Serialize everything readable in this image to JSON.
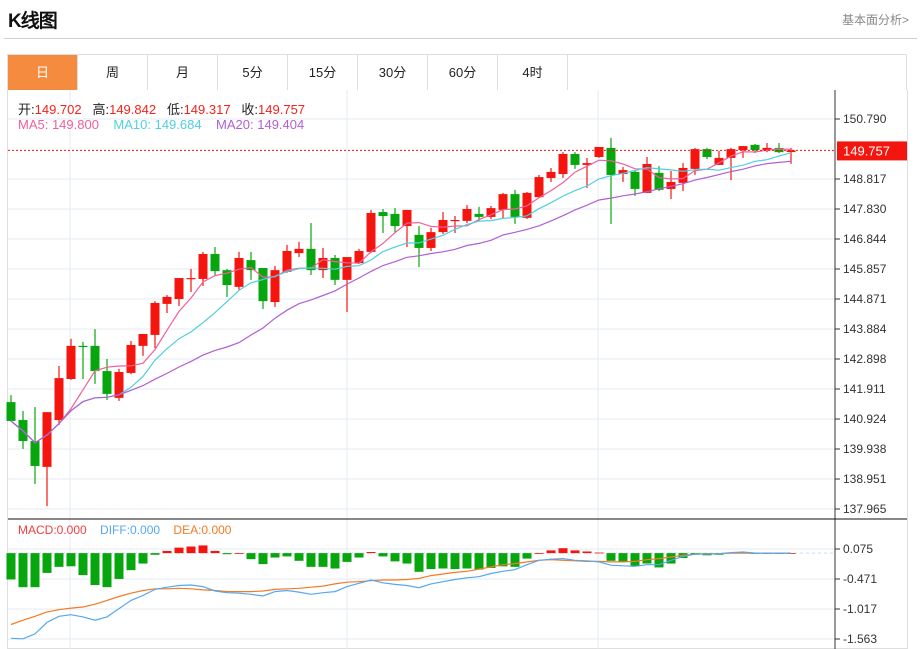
{
  "header": {
    "title": "K线图",
    "link": "基本面分析>"
  },
  "tabs": [
    {
      "label": "日",
      "active": true
    },
    {
      "label": "周"
    },
    {
      "label": "月"
    },
    {
      "label": "5分"
    },
    {
      "label": "15分"
    },
    {
      "label": "30分"
    },
    {
      "label": "60分"
    },
    {
      "label": "4时"
    }
  ],
  "ohlc_legend": {
    "open_label": "开:",
    "open": "149.702",
    "high_label": "高:",
    "high": "149.842",
    "low_label": "低:",
    "low": "149.317",
    "close_label": "收:",
    "close": "149.757"
  },
  "ma_legend": {
    "ma5": "MA5: 149.800",
    "ma10": "MA10: 149.684",
    "ma20": "MA20: 149.404"
  },
  "macd_legend": {
    "macd": "MACD:0.000",
    "diff": "DIFF:0.000",
    "dea": "DEA:0.000"
  },
  "colors": {
    "up": "#f5150f",
    "down": "#08a60e",
    "ma5": "#f0609a",
    "ma10": "#4fcfe0",
    "ma20": "#b25fd2",
    "diff": "#55a8f0",
    "dea": "#f47a24",
    "tab_active": "#f48b3f"
  },
  "chart_data": [
    {
      "type": "candlestick",
      "title": "",
      "y_ticks": [
        "150.790",
        "148.817",
        "147.830",
        "146.844",
        "145.857",
        "144.871",
        "143.884",
        "142.898",
        "141.911",
        "140.924",
        "139.938",
        "138.951",
        "137.965"
      ],
      "ylim": [
        137.965,
        150.79
      ],
      "last_price": "149.757",
      "grid": true,
      "candles": [
        [
          141.48,
          141.71,
          140.86,
          140.86
        ],
        [
          140.89,
          141.19,
          139.94,
          140.2
        ],
        [
          140.2,
          141.32,
          138.79,
          139.38
        ],
        [
          139.35,
          141.15,
          138.06,
          141.15
        ],
        [
          140.89,
          142.67,
          140.73,
          142.27
        ],
        [
          142.24,
          143.56,
          142.21,
          143.33
        ],
        [
          143.33,
          143.46,
          142.24,
          143.29
        ],
        [
          143.33,
          143.88,
          142.08,
          142.5
        ],
        [
          142.5,
          142.9,
          141.55,
          141.75
        ],
        [
          141.62,
          142.57,
          141.52,
          142.47
        ],
        [
          142.44,
          143.49,
          142.4,
          143.36
        ],
        [
          143.33,
          143.72,
          143.0,
          143.72
        ],
        [
          143.69,
          144.8,
          143.26,
          144.74
        ],
        [
          144.71,
          145.0,
          144.41,
          144.94
        ],
        [
          144.87,
          145.56,
          144.64,
          145.56
        ],
        [
          145.53,
          145.86,
          145.1,
          145.56
        ],
        [
          145.53,
          146.42,
          145.3,
          146.35
        ],
        [
          146.35,
          146.58,
          145.66,
          145.79
        ],
        [
          145.82,
          145.86,
          144.94,
          145.33
        ],
        [
          145.27,
          146.42,
          145.17,
          146.22
        ],
        [
          146.15,
          146.42,
          145.5,
          145.82
        ],
        [
          145.89,
          145.89,
          144.54,
          144.8
        ],
        [
          144.77,
          145.96,
          144.61,
          145.82
        ],
        [
          145.76,
          146.65,
          145.73,
          146.45
        ],
        [
          146.38,
          146.75,
          146.25,
          146.52
        ],
        [
          146.52,
          147.37,
          145.66,
          145.82
        ],
        [
          145.82,
          146.55,
          145.56,
          146.22
        ],
        [
          146.22,
          146.32,
          145.33,
          145.5
        ],
        [
          145.5,
          146.25,
          144.44,
          146.25
        ],
        [
          146.05,
          146.52,
          146.02,
          146.45
        ],
        [
          146.42,
          147.8,
          146.38,
          147.7
        ],
        [
          147.73,
          147.83,
          147.04,
          147.6
        ],
        [
          147.67,
          147.86,
          147.04,
          147.27
        ],
        [
          147.27,
          147.8,
          146.58,
          147.8
        ],
        [
          146.98,
          147.27,
          145.92,
          146.55
        ],
        [
          146.55,
          147.21,
          146.45,
          147.07
        ],
        [
          147.07,
          147.73,
          147.01,
          147.47
        ],
        [
          147.44,
          147.6,
          147.04,
          147.47
        ],
        [
          147.44,
          147.96,
          147.37,
          147.83
        ],
        [
          147.67,
          147.9,
          147.44,
          147.57
        ],
        [
          147.57,
          147.93,
          147.5,
          147.86
        ],
        [
          147.8,
          148.36,
          147.5,
          148.32
        ],
        [
          148.32,
          148.46,
          147.34,
          147.57
        ],
        [
          147.54,
          148.39,
          147.5,
          148.36
        ],
        [
          148.22,
          148.95,
          148.22,
          148.88
        ],
        [
          148.85,
          149.18,
          148.72,
          149.05
        ],
        [
          148.98,
          149.7,
          148.85,
          149.64
        ],
        [
          149.64,
          149.7,
          149.15,
          149.28
        ],
        [
          149.28,
          149.51,
          148.52,
          149.34
        ],
        [
          149.54,
          149.87,
          149.51,
          149.87
        ],
        [
          149.84,
          150.17,
          147.34,
          148.95
        ],
        [
          148.98,
          149.21,
          148.72,
          149.11
        ],
        [
          149.05,
          149.11,
          148.26,
          148.49
        ],
        [
          148.36,
          149.54,
          148.36,
          149.31
        ],
        [
          149.02,
          149.24,
          148.42,
          148.46
        ],
        [
          148.49,
          149.08,
          148.16,
          148.72
        ],
        [
          148.69,
          149.34,
          148.42,
          149.18
        ],
        [
          149.15,
          149.84,
          148.95,
          149.8
        ],
        [
          149.8,
          149.84,
          149.47,
          149.54
        ],
        [
          149.28,
          149.74,
          149.28,
          149.51
        ],
        [
          149.51,
          149.84,
          148.78,
          149.8
        ],
        [
          149.77,
          149.9,
          149.51,
          149.9
        ],
        [
          149.94,
          149.97,
          149.67,
          149.77
        ],
        [
          149.77,
          150.0,
          149.7,
          149.84
        ],
        [
          149.84,
          150.0,
          149.67,
          149.7
        ],
        [
          149.702,
          149.842,
          149.317,
          149.757
        ]
      ],
      "ma_periods": [
        5,
        10,
        20
      ]
    },
    {
      "type": "macd",
      "y_ticks": [
        "0.075",
        "-0.471",
        "-1.017",
        "-1.563"
      ],
      "ylim": [
        -1.563,
        0.075
      ],
      "histogram": [
        -0.48,
        -0.62,
        -0.62,
        -0.36,
        -0.25,
        -0.24,
        -0.4,
        -0.58,
        -0.62,
        -0.47,
        -0.31,
        -0.19,
        -0.03,
        0.04,
        0.1,
        0.12,
        0.14,
        0.04,
        -0.02,
        0.0,
        -0.11,
        -0.2,
        -0.08,
        -0.06,
        -0.14,
        -0.25,
        -0.25,
        -0.28,
        -0.16,
        -0.08,
        0.02,
        -0.06,
        -0.15,
        -0.19,
        -0.34,
        -0.29,
        -0.28,
        -0.29,
        -0.28,
        -0.3,
        -0.27,
        -0.24,
        -0.25,
        -0.1,
        0.0,
        0.05,
        0.09,
        0.05,
        0.03,
        0.01,
        -0.14,
        -0.16,
        -0.24,
        -0.19,
        -0.26,
        -0.19,
        -0.09,
        -0.02,
        -0.04,
        -0.03,
        0.01,
        0.01,
        -0.01,
        0.0,
        0.0,
        0.0
      ],
      "diff": [
        -1.55,
        -1.56,
        -1.47,
        -1.26,
        -1.15,
        -1.12,
        -1.16,
        -1.22,
        -1.16,
        -1.01,
        -0.86,
        -0.77,
        -0.66,
        -0.62,
        -0.59,
        -0.58,
        -0.61,
        -0.69,
        -0.72,
        -0.73,
        -0.75,
        -0.78,
        -0.7,
        -0.68,
        -0.71,
        -0.75,
        -0.72,
        -0.7,
        -0.61,
        -0.55,
        -0.49,
        -0.54,
        -0.57,
        -0.59,
        -0.63,
        -0.56,
        -0.52,
        -0.48,
        -0.45,
        -0.43,
        -0.37,
        -0.33,
        -0.3,
        -0.21,
        -0.13,
        -0.11,
        -0.1,
        -0.13,
        -0.14,
        -0.16,
        -0.22,
        -0.23,
        -0.24,
        -0.21,
        -0.21,
        -0.13,
        -0.06,
        -0.02,
        -0.02,
        -0.01,
        0.01,
        0.02,
        0.0,
        0.0,
        0.0,
        0.0
      ],
      "dea": [
        -1.3,
        -1.22,
        -1.15,
        -1.07,
        -1.03,
        -1.0,
        -0.98,
        -0.93,
        -0.86,
        -0.79,
        -0.73,
        -0.68,
        -0.65,
        -0.65,
        -0.64,
        -0.65,
        -0.67,
        -0.68,
        -0.7,
        -0.7,
        -0.7,
        -0.69,
        -0.66,
        -0.65,
        -0.64,
        -0.62,
        -0.6,
        -0.56,
        -0.53,
        -0.52,
        -0.5,
        -0.49,
        -0.49,
        -0.48,
        -0.46,
        -0.41,
        -0.38,
        -0.35,
        -0.33,
        -0.29,
        -0.25,
        -0.21,
        -0.19,
        -0.16,
        -0.13,
        -0.12,
        -0.13,
        -0.14,
        -0.15,
        -0.15,
        -0.16,
        -0.16,
        -0.15,
        -0.12,
        -0.1,
        -0.07,
        -0.04,
        -0.02,
        -0.01,
        -0.01,
        0.0,
        0.0,
        0.0,
        0.0,
        0.0,
        0.0
      ]
    }
  ]
}
